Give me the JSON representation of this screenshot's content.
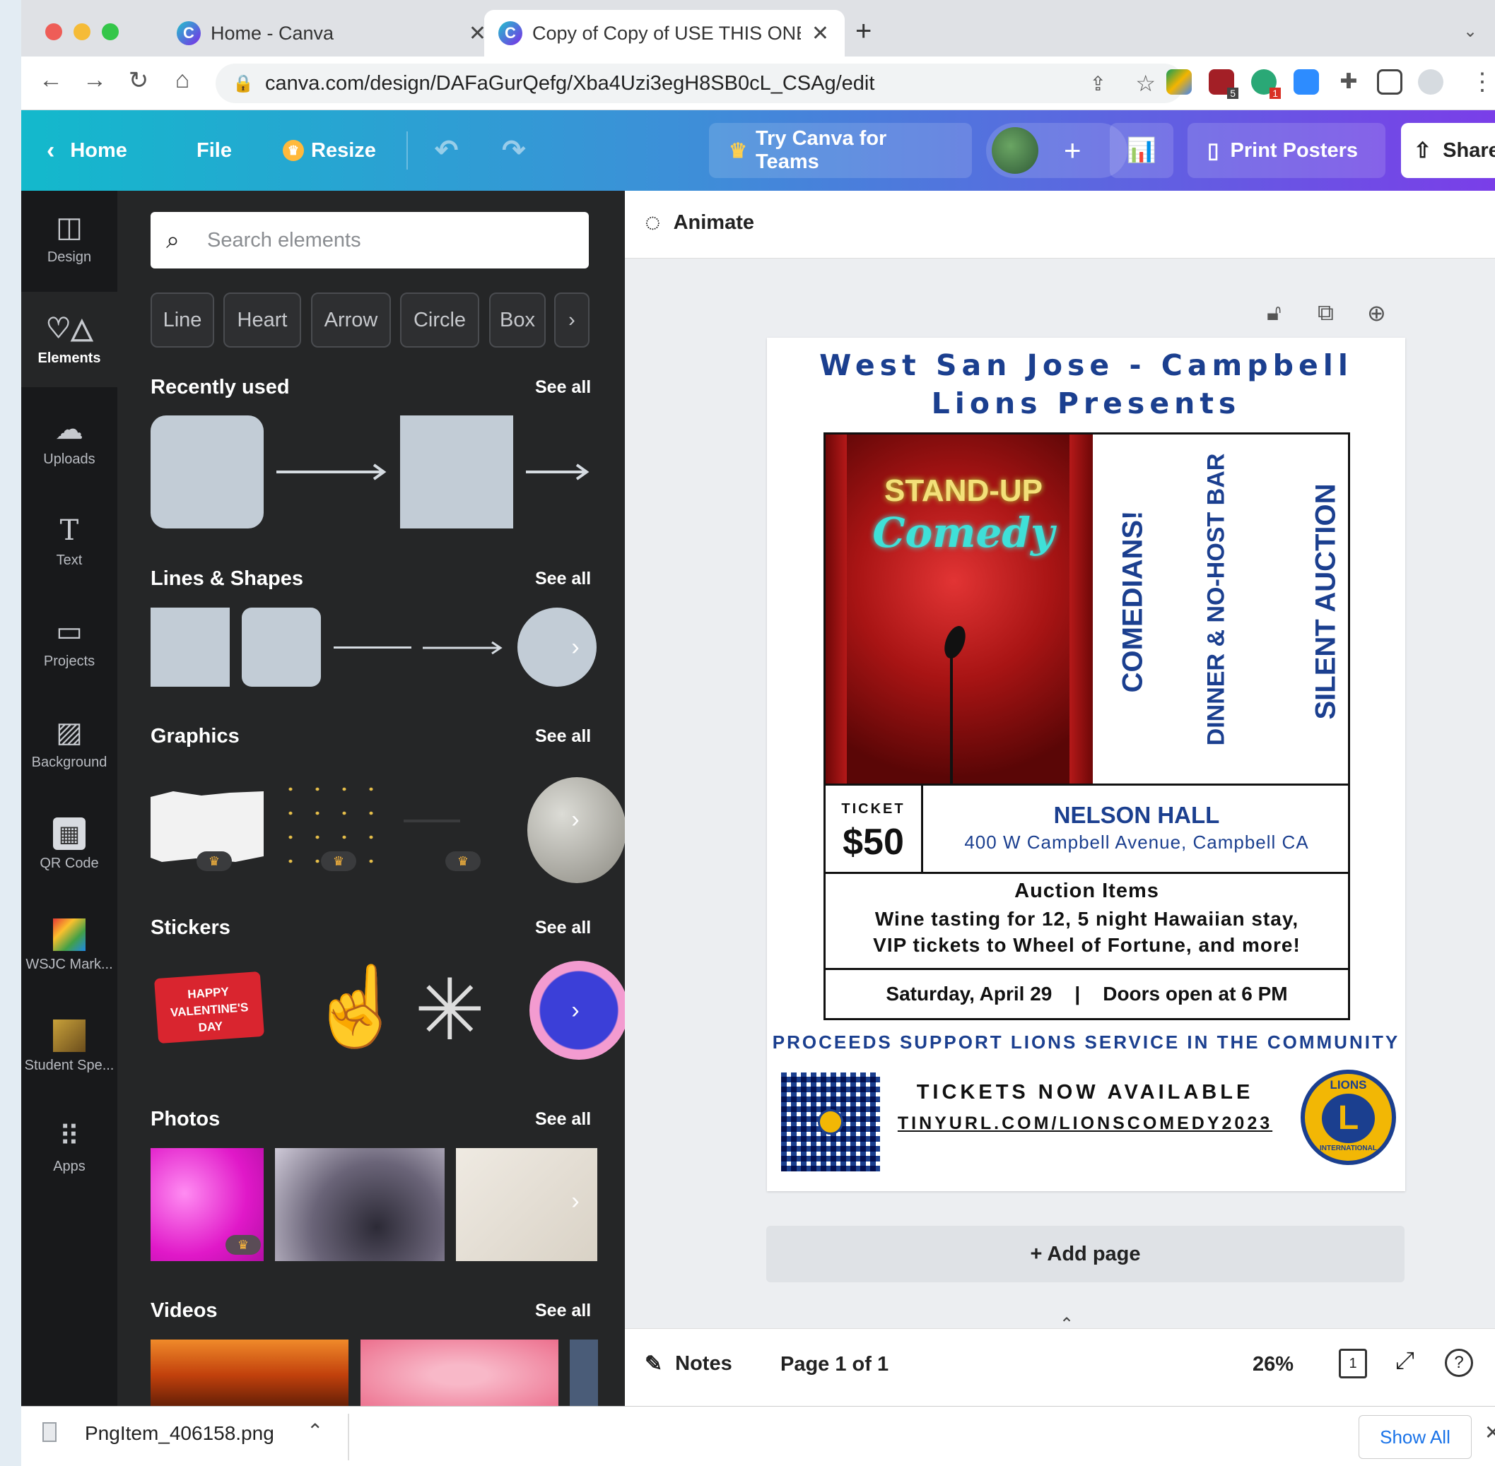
{
  "browser": {
    "tabs": [
      {
        "title": "Home - Canva"
      },
      {
        "title": "Copy of Copy of USE THIS ONE"
      }
    ],
    "url": "canva.com/design/DAFaGurQefg/Xba4Uzi3egH8SB0cL_CSAg/edit",
    "ext_badges": [
      "5",
      "1"
    ]
  },
  "topbar": {
    "home": "Home",
    "file": "File",
    "resize": "Resize",
    "try_teams": "Try Canva for Teams",
    "print": "Print Posters",
    "share": "Share"
  },
  "rail": {
    "items": [
      "Design",
      "Elements",
      "Uploads",
      "Text",
      "Projects",
      "Background",
      "QR Code",
      "WSJC Mark...",
      "Student Spe...",
      "Apps"
    ]
  },
  "panel": {
    "search_placeholder": "Search elements",
    "chips": [
      "Line",
      "Heart",
      "Arrow",
      "Circle",
      "Box"
    ],
    "sections": [
      "Recently used",
      "Lines & Shapes",
      "Graphics",
      "Stickers",
      "Photos",
      "Videos"
    ],
    "see_all": "See all",
    "sticker_text": "HAPPY VALENTINE'S DAY"
  },
  "editor": {
    "animate": "Animate",
    "add_page": "+ Add page",
    "notes": "Notes",
    "page_indicator": "Page 1 of 1",
    "zoom": "26%",
    "page_count_badge": "1"
  },
  "poster": {
    "title": "West San Jose - Campbell Lions Presents",
    "neon_line1": "STAND-UP",
    "neon_line2": "Comedy",
    "vertical": [
      "COMEDIANS!",
      "DINNER & NO-HOST BAR",
      "SILENT AUCTION"
    ],
    "ticket_label": "TICKET",
    "ticket_price": "$50",
    "venue": "NELSON HALL",
    "address": "400 W Campbell Avenue, Campbell CA",
    "auction_title": "Auction Items",
    "auction_line1": "Wine tasting for 12, 5 night Hawaiian stay,",
    "auction_line2": "VIP tickets to Wheel of Fortune, and more!",
    "date": "Saturday, April 29",
    "separator": "|",
    "doors": "Doors open at 6 PM",
    "proceeds": "PROCEEDS SUPPORT LIONS SERVICE IN THE COMMUNITY",
    "tickets_available": "TICKETS NOW AVAILABLE",
    "tinyurl": "TINYURL.COM/LIONSCOMEDY2023",
    "logo_top": "LIONS",
    "logo_letter": "L",
    "logo_bottom": "INTERNATIONAL"
  },
  "download": {
    "file": "PngItem_406158.png",
    "show_all": "Show All"
  },
  "colors": {
    "accent_teal": "#13b9cc",
    "accent_purple": "#7a3ee8",
    "poster_blue": "#1b3f8f",
    "panel_bg": "#252627",
    "rail_bg": "#18191b"
  }
}
